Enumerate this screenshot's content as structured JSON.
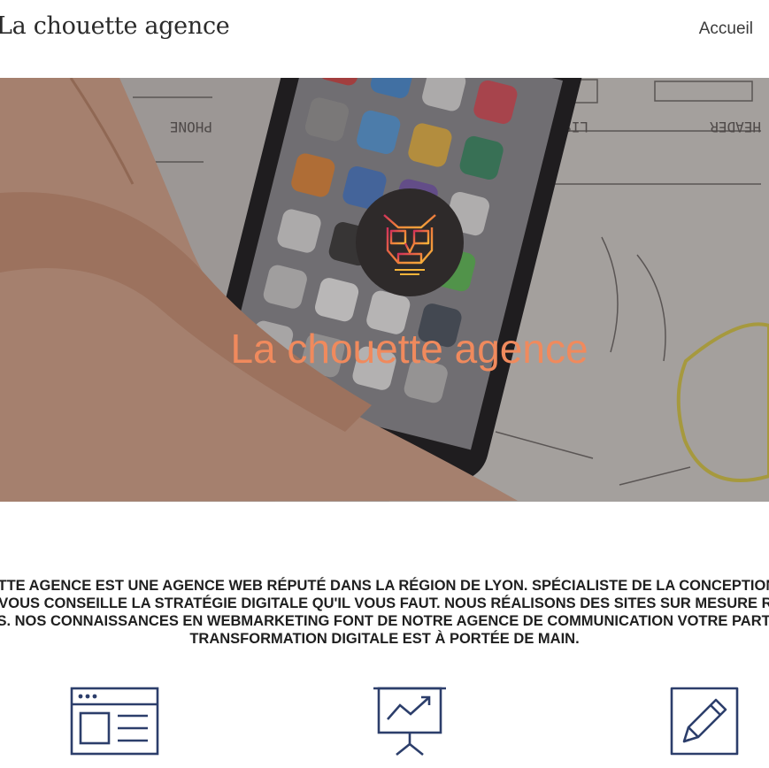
{
  "header": {
    "brand": "La chouette agence",
    "nav": [
      {
        "label": "Accueil"
      }
    ]
  },
  "hero": {
    "title": "La chouette agence",
    "logo_icon": "owl-logo-icon",
    "background_image": "smartphone-on-wireframe-sketches-photo"
  },
  "intro": {
    "lines": [
      "La chouette agence est une agence web réputé dans la région de Lyon. Spécialiste de la conception de sites",
      "web, elle vous conseille la stratégie digitale qu'il vous faut. Nous réalisons des sites sur mesure répondant",
      "à vos besoins. Nos connaissances en webmarketing font de notre agence de communication votre partenaire idéal.",
      "Transformation digitale est à portée de main."
    ]
  },
  "services": [
    {
      "icon": "web-page-layout-icon"
    },
    {
      "icon": "presentation-chart-icon"
    },
    {
      "icon": "pencil-edit-icon"
    }
  ],
  "colors": {
    "accent": "#f08a5d",
    "icon_navy": "#2c3e6b",
    "logo_bg": "#2e2a2a"
  }
}
